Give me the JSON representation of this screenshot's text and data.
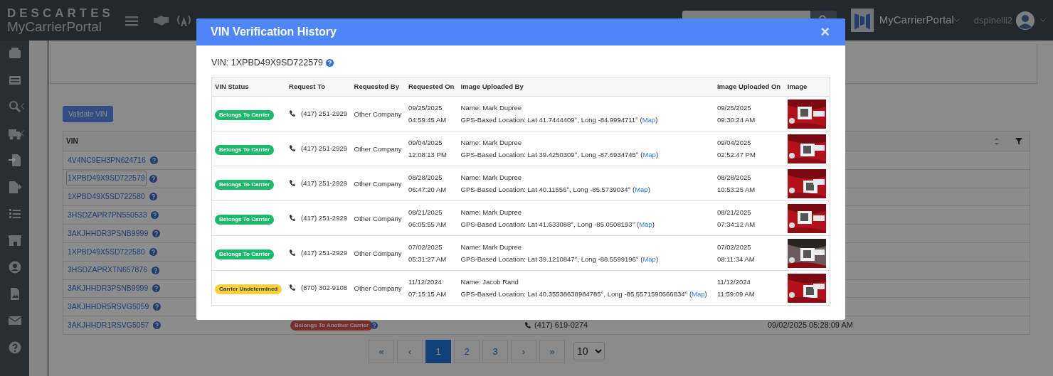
{
  "navbar": {
    "logo_top": "DESCARTES",
    "logo_bottom": "MyCarrierPortal",
    "portal_menu": "MyCarrierPortal",
    "user": "dspinelli2"
  },
  "sidebar": {
    "items": [
      {
        "expandable": false
      },
      {
        "expandable": false
      },
      {
        "expandable": true
      },
      {
        "expandable": true
      },
      {
        "expandable": false
      },
      {
        "expandable": false
      },
      {
        "expandable": false
      },
      {
        "expandable": false
      },
      {
        "expandable": false
      },
      {
        "expandable": false
      },
      {
        "expandable": false
      },
      {
        "expandable": false
      }
    ]
  },
  "content": {
    "validate_button": "Validate VIN",
    "table": {
      "columns": [
        "VIN"
      ],
      "rows": [
        {
          "vin": "4V4NC9EH3PN624716",
          "focused": false
        },
        {
          "vin": "1XPBD49X9SD722579",
          "focused": true
        },
        {
          "vin": "1XPBD49X5SD722580",
          "focused": false
        },
        {
          "vin": "3HSDZAPR7PN550533",
          "focused": false
        },
        {
          "vin": "3AKJHHDR3PSNB9999",
          "focused": false
        },
        {
          "vin": "1XPBD49X5SD722580",
          "focused": false
        },
        {
          "vin": "3HSDZAPRXTN657876",
          "focused": false
        },
        {
          "vin": "3AKJHHDR3PSNB9999",
          "focused": false
        },
        {
          "vin": "3AKJHHDR5RSVG5059",
          "focused": false
        },
        {
          "vin": "3AKJHHDR1RSVG5057",
          "focused": false,
          "status": {
            "label": "Belongs To Another Carrier"
          },
          "phone": "(417) 619-0274",
          "uploaded_on": "09/02/2025 05:28:09 AM"
        }
      ]
    },
    "pagination": {
      "pages": [
        {
          "label": "«",
          "selected": false
        },
        {
          "label": "‹",
          "selected": false
        },
        {
          "label": "1",
          "selected": true
        },
        {
          "label": "2",
          "selected": false
        },
        {
          "label": "3",
          "selected": false
        },
        {
          "label": "›",
          "selected": false
        },
        {
          "label": "»",
          "selected": false
        }
      ],
      "page_size": "10"
    }
  },
  "modal": {
    "title": "VIN Verification History",
    "close": "×",
    "vin": "VIN: 1XPBD49X9SD722579",
    "columns": [
      "VIN Status",
      "Request To",
      "Requested By",
      "Requested On",
      "Image Uploaded By",
      "Image Uploaded On",
      "Image"
    ],
    "rows": [
      {
        "status": {
          "label": "Belongs To Carrier",
          "color": "#1cb86b"
        },
        "request_to": "(417) 251-2929",
        "requested_by": "Other Company",
        "requested_on": [
          "09/25/2025",
          "04:59:45 AM"
        ],
        "name": "Name: Mark Dupree",
        "gps": {
          "before": "GPS-Based Location: Lat 41.7444409°, Long -84.9994711° (",
          "link": "Map",
          "after": ")"
        },
        "uploaded_on": [
          "09/25/2025",
          "09:30:24 AM"
        ]
      },
      {
        "status": {
          "label": "Belongs To Carrier",
          "color": "#1cb86b"
        },
        "request_to": "(417) 251-2929",
        "requested_by": "Other Company",
        "requested_on": [
          "09/04/2025",
          "12:08:13 PM"
        ],
        "name": "Name: Mark Dupree",
        "gps": {
          "before": "GPS-Based Location: Lat 39.4250309°, Long -87.6934745° (",
          "link": "Map",
          "after": ")"
        },
        "uploaded_on": [
          "09/04/2025",
          "02:52:47 PM"
        ]
      },
      {
        "status": {
          "label": "Belongs To Carrier",
          "color": "#1cb86b"
        },
        "request_to": "(417) 251-2929",
        "requested_by": "Other Company",
        "requested_on": [
          "08/28/2025",
          "06:47:20 AM"
        ],
        "name": "Name: Mark Dupree",
        "gps": {
          "before": "GPS-Based Location: Lat 40.11556°, Long -85.5739034° (",
          "link": "Map",
          "after": ")"
        },
        "uploaded_on": [
          "08/28/2025",
          "10:53:25 AM"
        ]
      },
      {
        "status": {
          "label": "Belongs To Carrier",
          "color": "#1cb86b"
        },
        "request_to": "(417) 251-2929",
        "requested_by": "Other Company",
        "requested_on": [
          "08/21/2025",
          "06:05:55 AM"
        ],
        "name": "Name: Mark Dupree",
        "gps": {
          "before": "GPS-Based Location: Lat 41.633088°, Long -85.0508193° (",
          "link": "Map",
          "after": ")"
        },
        "uploaded_on": [
          "08/21/2025",
          "07:34:12 AM"
        ]
      },
      {
        "status": {
          "label": "Belongs To Carrier",
          "color": "#1cb86b"
        },
        "request_to": "(417) 251-2929",
        "requested_by": "Other Company",
        "requested_on": [
          "07/02/2025",
          "05:31:27 AM"
        ],
        "name": "Name: Mark Dupree",
        "gps": {
          "before": "GPS-Based Location: Lat 39.1210847°, Long -88.5599196° (",
          "link": "Map",
          "after": ")"
        },
        "uploaded_on": [
          "07/02/2025",
          "08:11:34 AM"
        ]
      },
      {
        "status": {
          "label": "Carrier Undetermined",
          "color": "#f7d13d"
        },
        "request_to": "(870) 302-9108",
        "requested_by": "Other Company",
        "requested_on": [
          "11/12/2024",
          "07:15:15 AM"
        ],
        "name": "Name: Jacob Rand",
        "gps": {
          "before": "GPS-Based Location: Lat 40.35538638984785°, Long -85.5571590666834° (",
          "link": "Map",
          "after": ")"
        },
        "uploaded_on": [
          "11/12/2024",
          "11:59:09 AM"
        ]
      }
    ]
  }
}
